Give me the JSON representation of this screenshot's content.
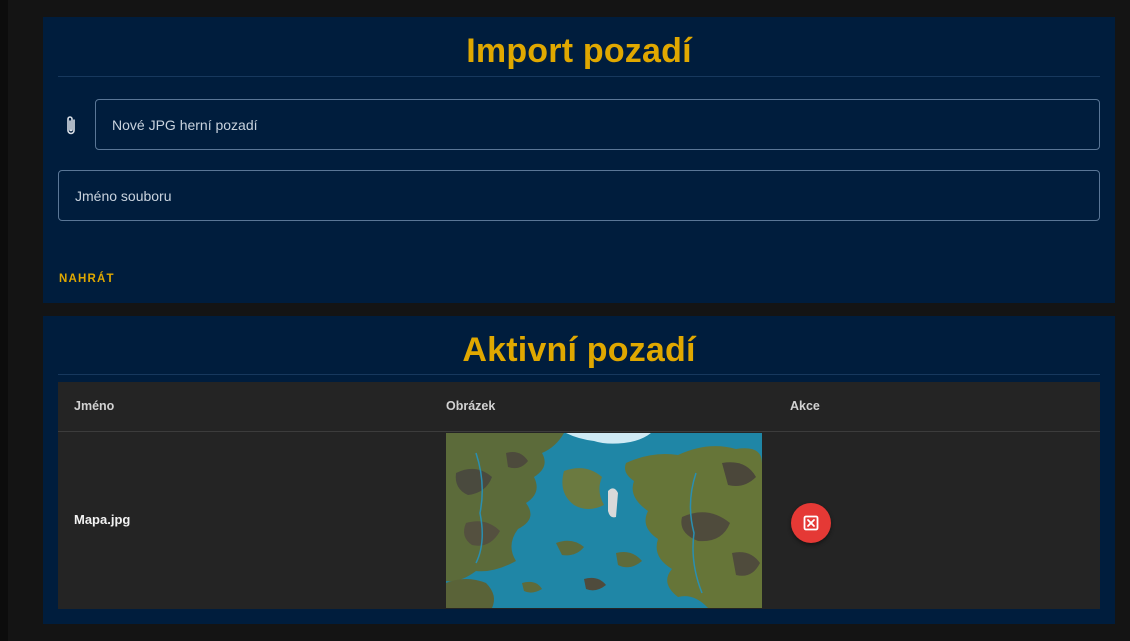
{
  "import_panel": {
    "title": "Import pozadí",
    "file_input": {
      "placeholder": "Nové JPG herní pozadí",
      "value": "",
      "icon": "paperclip-icon"
    },
    "name_input": {
      "placeholder": "Jméno souboru",
      "value": ""
    },
    "upload_label": "NAHRÁT"
  },
  "active_panel": {
    "title": "Aktivní pozadí",
    "table": {
      "headers": [
        "Jméno",
        "Obrázek",
        "Akce"
      ],
      "rows": [
        {
          "name": "Mapa.jpg",
          "image": "fantasy-world-map-thumbnail",
          "action_icon": "close-box-icon"
        }
      ]
    }
  },
  "colors": {
    "background": "#141414",
    "panel": "#001d3d",
    "accent": "#e0a800",
    "table": "#242424",
    "delete": "#e53935"
  }
}
